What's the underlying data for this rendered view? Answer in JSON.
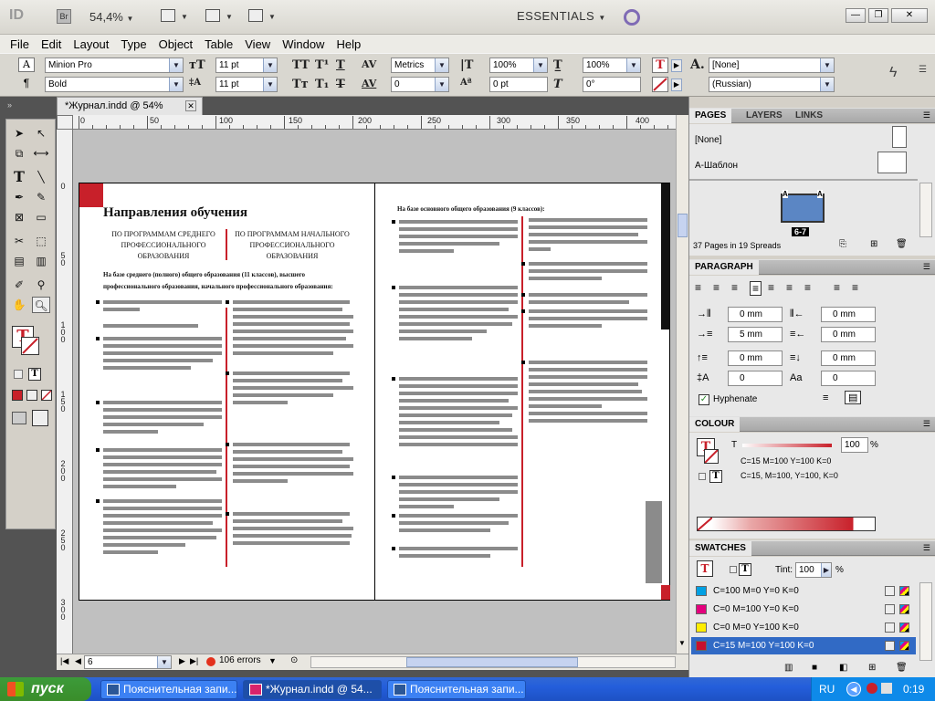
{
  "appbar": {
    "logo": "ID",
    "bridge": "Br",
    "zoom": "54,4%",
    "workspace": "ESSENTIALS",
    "win_min": "—",
    "win_max": "❐",
    "win_close": "✕"
  },
  "menu": [
    "File",
    "Edit",
    "Layout",
    "Type",
    "Object",
    "Table",
    "View",
    "Window",
    "Help"
  ],
  "control": {
    "font_family": "Minion Pro",
    "font_style": "Bold",
    "font_size": "11 pt",
    "leading": "11 pt",
    "kerning": "Metrics",
    "tracking": "0",
    "vscale": "100%",
    "hscale": "100%",
    "baseline": "0 pt",
    "skew": "0°",
    "char_style": "[None]",
    "language": "(Russian)"
  },
  "document": {
    "tab_title": "*Журнал.indd @ 54%",
    "ruler_h": [
      "0",
      "50",
      "100",
      "150",
      "200",
      "250",
      "300",
      "350",
      "400"
    ],
    "ruler_v": [
      "0",
      "5 0",
      "1 0 0",
      "1 5 0",
      "2 0 0",
      "2 5 0",
      "3 0 0"
    ],
    "page_heading": "Направления обучения",
    "col1_heading": "ПО ПРОГРАММАМ СРЕДНЕГО ПРОФЕССИОНАЛЬНОГО ОБРАЗОВАНИЯ",
    "col2_heading": "ПО ПРОГРАММАМ НАЧАЛЬНОГО ПРОФЕССИОНАЛЬНОГО ОБРАЗОВАНИЯ",
    "intro_text": "На базе среднего (полного) общего образования (11 классов), высшего профессионального образования, начального профессионального образования:",
    "right_heading": "На базе основного общего образования (9 классов):"
  },
  "status": {
    "page": "6",
    "errors": "106 errors"
  },
  "panels": {
    "pages_tab": "PAGES",
    "layers_tab": "LAYERS",
    "links_tab": "LINKS",
    "none_master": "[None]",
    "a_master": "А-Шаблон",
    "spread_label": "6-7",
    "pages_info": "37 Pages in 19 Spreads",
    "paragraph_tab": "PARAGRAPH",
    "left_indent": "0 mm",
    "right_indent": "0 mm",
    "first_indent": "5 mm",
    "last_indent": "0 mm",
    "space_before": "0 mm",
    "space_after": "0 mm",
    "drop_lines": "0",
    "drop_chars": "0",
    "hyphenate": "Hyphenate",
    "colour_tab": "COLOUR",
    "colour_t": "T",
    "colour_value": "100",
    "colour_pct": "%",
    "colour_fill": "C=15 M=100 Y=100 K=0",
    "colour_stroke": "C=15, M=100, Y=100, K=0",
    "swatches_tab": "SWATCHES",
    "tint_label": "Tint:",
    "tint_value": "100",
    "swatches": [
      {
        "name": "C=100 M=0 Y=0 K=0",
        "color": "#00a0e3"
      },
      {
        "name": "C=0 M=100 Y=0 K=0",
        "color": "#e4007d"
      },
      {
        "name": "C=0 M=0 Y=100 K=0",
        "color": "#ffed00"
      },
      {
        "name": "C=15 M=100 Y=100 K=0",
        "color": "#c8102e"
      }
    ]
  },
  "taskbar": {
    "start": "пуск",
    "items": [
      "Пояснительная запи...",
      "*Журнал.indd @ 54...",
      "Пояснительная запи..."
    ],
    "lang": "RU",
    "time": "0:19"
  },
  "colors": {
    "accent_red": "#c8202a",
    "selection_blue": "#316ac5"
  }
}
